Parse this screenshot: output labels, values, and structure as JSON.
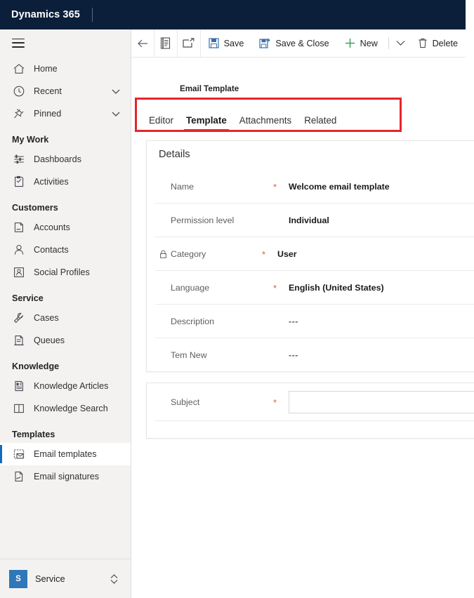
{
  "app": {
    "brand": "Dynamics 365"
  },
  "sidebar": {
    "menu_icon": "hamburger-icon",
    "items": [
      {
        "label": "Home",
        "icon": "home-icon",
        "kind": "item",
        "chevron": false,
        "selected": false
      },
      {
        "label": "Recent",
        "icon": "clock-icon",
        "kind": "item",
        "chevron": true,
        "selected": false
      },
      {
        "label": "Pinned",
        "icon": "pin-icon",
        "kind": "item",
        "chevron": true,
        "selected": false
      },
      {
        "label": "My Work",
        "kind": "group"
      },
      {
        "label": "Dashboards",
        "icon": "dashboard-icon",
        "kind": "item",
        "chevron": false,
        "selected": false
      },
      {
        "label": "Activities",
        "icon": "activities-icon",
        "kind": "item",
        "chevron": false,
        "selected": false
      },
      {
        "label": "Customers",
        "kind": "group"
      },
      {
        "label": "Accounts",
        "icon": "account-icon",
        "kind": "item",
        "chevron": false,
        "selected": false
      },
      {
        "label": "Contacts",
        "icon": "contact-icon",
        "kind": "item",
        "chevron": false,
        "selected": false
      },
      {
        "label": "Social Profiles",
        "icon": "social-profile-icon",
        "kind": "item",
        "chevron": false,
        "selected": false
      },
      {
        "label": "Service",
        "kind": "group"
      },
      {
        "label": "Cases",
        "icon": "case-icon",
        "kind": "item",
        "chevron": false,
        "selected": false
      },
      {
        "label": "Queues",
        "icon": "queue-icon",
        "kind": "item",
        "chevron": false,
        "selected": false
      },
      {
        "label": "Knowledge",
        "kind": "group"
      },
      {
        "label": "Knowledge Articles",
        "icon": "article-icon",
        "kind": "item",
        "chevron": false,
        "selected": false
      },
      {
        "label": "Knowledge Search",
        "icon": "book-icon",
        "kind": "item",
        "chevron": false,
        "selected": false
      },
      {
        "label": "Templates",
        "kind": "group"
      },
      {
        "label": "Email templates",
        "icon": "email-template-icon",
        "kind": "item",
        "chevron": false,
        "selected": true
      },
      {
        "label": "Email signatures",
        "icon": "signature-icon",
        "kind": "item",
        "chevron": false,
        "selected": false
      }
    ],
    "area_switcher": {
      "initial": "S",
      "label": "Service",
      "icon": "updown-chevron-icon"
    }
  },
  "commandbar": {
    "back": {
      "label": "",
      "icon": "back-arrow-icon"
    },
    "form_selector": {
      "label": "",
      "icon": "form-icon"
    },
    "popout": {
      "label": "",
      "icon": "open-in-new-window-icon"
    },
    "save": {
      "label": "Save",
      "icon": "save-icon"
    },
    "save_close": {
      "label": "Save & Close",
      "icon": "save-and-close-icon"
    },
    "new": {
      "label": "New",
      "icon": "plus-icon"
    },
    "overflow": {
      "label": "",
      "icon": "chevron-down-icon"
    },
    "delete": {
      "label": "Delete",
      "icon": "trash-icon"
    }
  },
  "record": {
    "entity_type": "Email Template",
    "tabs": [
      {
        "label": "Editor",
        "active": false
      },
      {
        "label": "Template",
        "active": true
      },
      {
        "label": "Attachments",
        "active": false
      },
      {
        "label": "Related",
        "active": false
      }
    ]
  },
  "details_card": {
    "title": "Details",
    "fields": [
      {
        "label": "Name",
        "required": true,
        "locked": false,
        "value": "Welcome email template"
      },
      {
        "label": "Permission level",
        "required": false,
        "locked": false,
        "value": "Individual"
      },
      {
        "label": "Category",
        "required": true,
        "locked": true,
        "value": "User"
      },
      {
        "label": "Language",
        "required": true,
        "locked": false,
        "value": "English (United States)"
      },
      {
        "label": "Description",
        "required": false,
        "locked": false,
        "value": "---"
      },
      {
        "label": "Tem New",
        "required": false,
        "locked": false,
        "value": "---"
      }
    ]
  },
  "subject_card": {
    "label": "Subject",
    "required": true,
    "value": "",
    "placeholder": ""
  },
  "annotation": {
    "shape": "rectangle",
    "color": "#e8242a",
    "target": "tabstrip"
  },
  "colors": {
    "header_navy": "#0b1f3a",
    "sidebar_bg": "#f3f2f1",
    "accent_blue": "#2b6cd4",
    "selected_indicator": "#0f6cbd",
    "required_asterisk": "#e05c4a",
    "annotation_red": "#e8242a",
    "area_tile": "#2e77b8"
  }
}
